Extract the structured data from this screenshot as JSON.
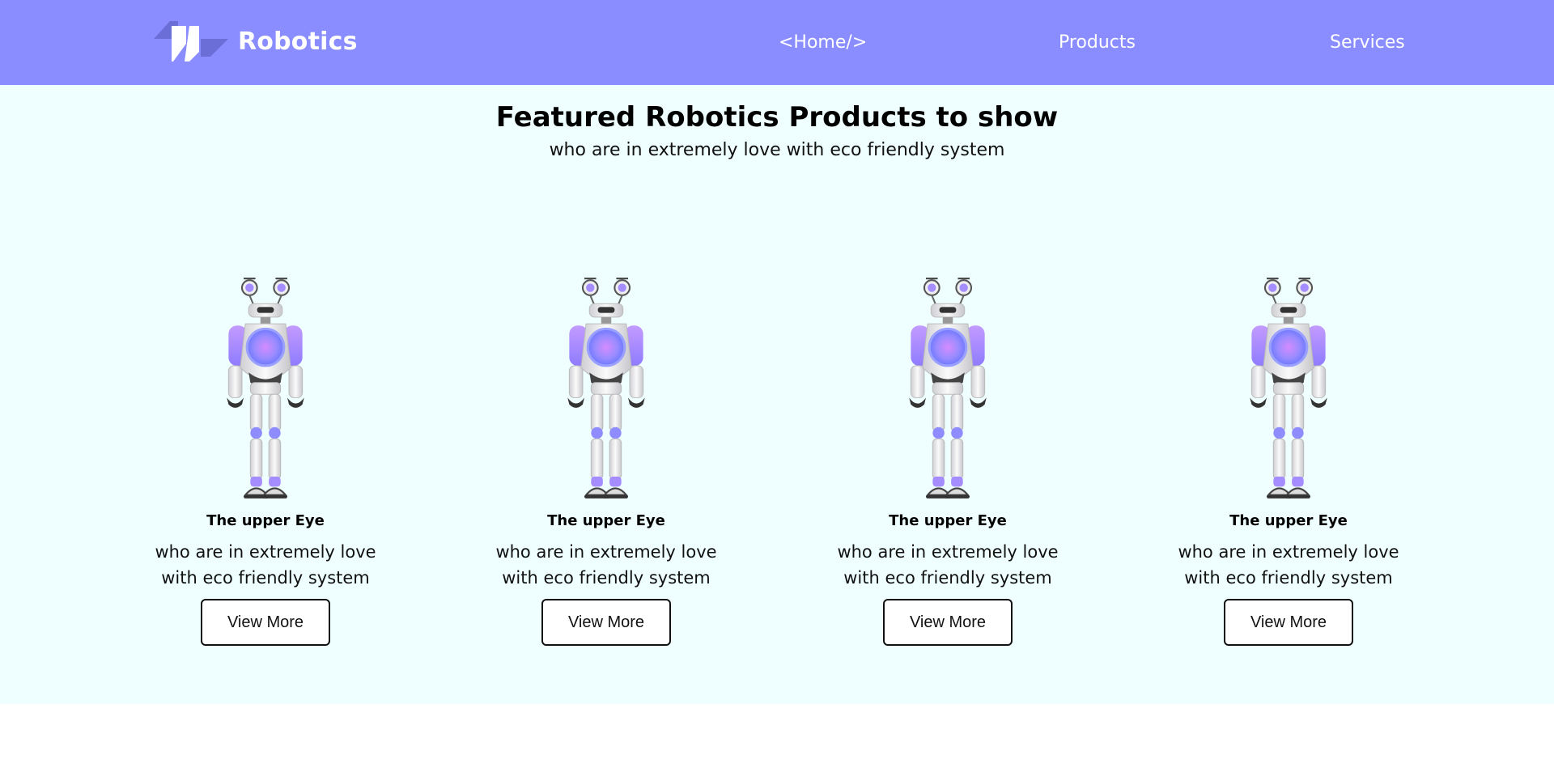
{
  "brand": {
    "name": "Robotics",
    "logo_icon": "stacked-blocks-logo-icon"
  },
  "nav": {
    "home": "<Home/>",
    "products": "Products",
    "services": "Services"
  },
  "featured": {
    "title": "Featured Robotics Products to show",
    "subtitle": "who are in extremely love with eco friendly system",
    "cards": [
      {
        "image": "robot-icon",
        "title": "The upper Eye",
        "description": "who are in extremely love with eco friendly system",
        "button": "View More"
      },
      {
        "image": "robot-icon",
        "title": "The upper Eye",
        "description": "who are in extremely love with eco friendly system",
        "button": "View More"
      },
      {
        "image": "robot-icon",
        "title": "The upper Eye",
        "description": "who are in extremely love with eco friendly system",
        "button": "View More"
      },
      {
        "image": "robot-icon",
        "title": "The upper Eye",
        "description": "who are in extremely love with eco friendly system",
        "button": "View More"
      }
    ]
  },
  "colors": {
    "navbar_bg": "#8a8dff",
    "section_bg": "#efffff",
    "robot_accent": "#a98bff"
  }
}
